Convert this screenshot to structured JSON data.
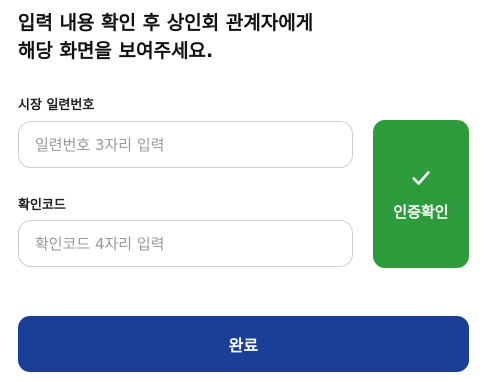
{
  "instruction": {
    "line1": "입력 내용 확인 후 상인회 관계자에게",
    "line2": "해당 화면을 보여주세요."
  },
  "serial_field": {
    "label": "시장 일련번호",
    "placeholder": "일련번호 3자리 입력",
    "value": ""
  },
  "code_field": {
    "label": "확인코드",
    "placeholder": "확인코드 4자리 입력",
    "value": ""
  },
  "verify_button": {
    "label": "인증확인",
    "icon": "check-icon",
    "color": "#2e9b3d"
  },
  "complete_button": {
    "label": "완료",
    "color": "#1a3f96"
  }
}
